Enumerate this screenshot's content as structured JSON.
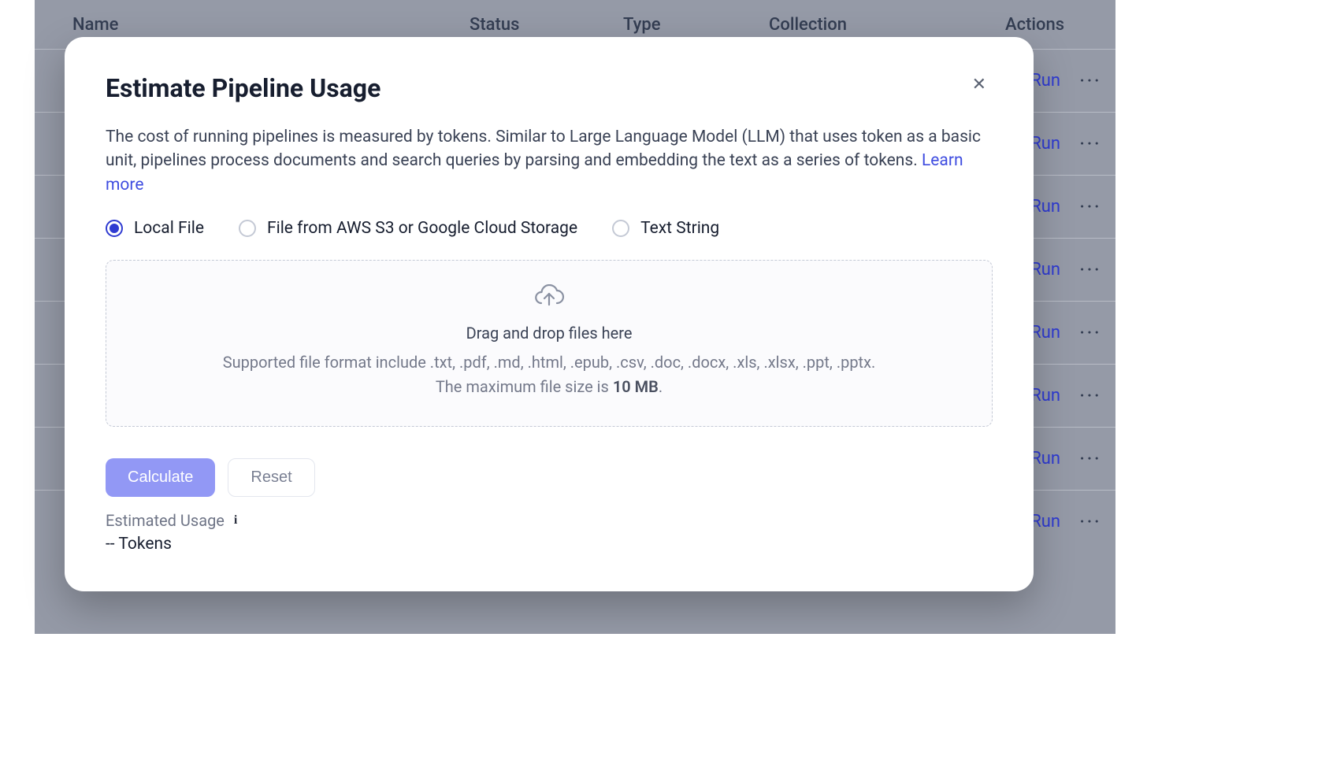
{
  "background": {
    "headers": {
      "name": "Name",
      "status": "Status",
      "type": "Type",
      "collection": "Collection",
      "actions": "Actions"
    },
    "row_action_label": "Run",
    "row_count": 8
  },
  "modal": {
    "title": "Estimate Pipeline Usage",
    "description_prefix": "The cost of running pipelines is measured by tokens. Similar to Large Language Model (LLM) that uses token as a basic unit, pipelines process documents and search queries by parsing and embedding the text as a series of tokens. ",
    "learn_more_label": "Learn more",
    "source_options": [
      {
        "id": "local",
        "label": "Local File",
        "selected": true
      },
      {
        "id": "cloud",
        "label": "File from AWS S3 or Google Cloud Storage",
        "selected": false
      },
      {
        "id": "text",
        "label": "Text String",
        "selected": false
      }
    ],
    "dropzone": {
      "title": "Drag and drop files here",
      "formats_line": "Supported file format include .txt, .pdf, .md, .html, .epub, .csv, .doc, .docx, .xls, .xlsx, .ppt, .pptx.",
      "size_line_prefix": "The maximum file size is ",
      "size_value": "10 MB",
      "size_line_suffix": "."
    },
    "buttons": {
      "calculate": "Calculate",
      "reset": "Reset"
    },
    "estimate": {
      "label": "Estimated Usage",
      "value": "-- Tokens"
    }
  },
  "colors": {
    "accent": "#2f3bd1",
    "primary_button": "#9298f5",
    "overlay": "#959aa7"
  }
}
